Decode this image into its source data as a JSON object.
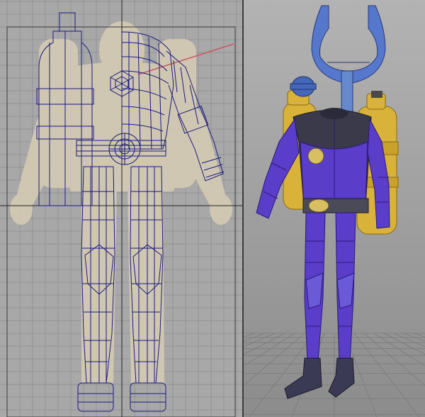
{
  "app": {
    "layout": "two-pane-3d-modeling",
    "panes": [
      {
        "id": "front",
        "view": "orthographic-front",
        "display": "wireframe-over-reference-image"
      },
      {
        "id": "persp",
        "view": "perspective",
        "display": "smooth-shaded-with-wireframe"
      }
    ]
  },
  "colors": {
    "front_bg": "#a8a8a8",
    "grid_line": "#8c8c8c",
    "reference_image": "#d8cdb4",
    "wire": "#1a1a80",
    "axis_line": "#222222",
    "selection_frame": "#3a3a3a",
    "persp_bg": "#a6a6a6",
    "persp_grid": "#7a7a7a",
    "suit_purple": "#5a3dc8",
    "suit_dark": "#3a3a4a",
    "tank_yellow": "#d9b23a",
    "harness_blue": "#5577cc",
    "badge_gold": "#d8c060",
    "boot_dark": "#3a3a55"
  },
  "icons": {
    "locator": "hexagon-locator-icon",
    "bottle": "bottle-icon"
  }
}
